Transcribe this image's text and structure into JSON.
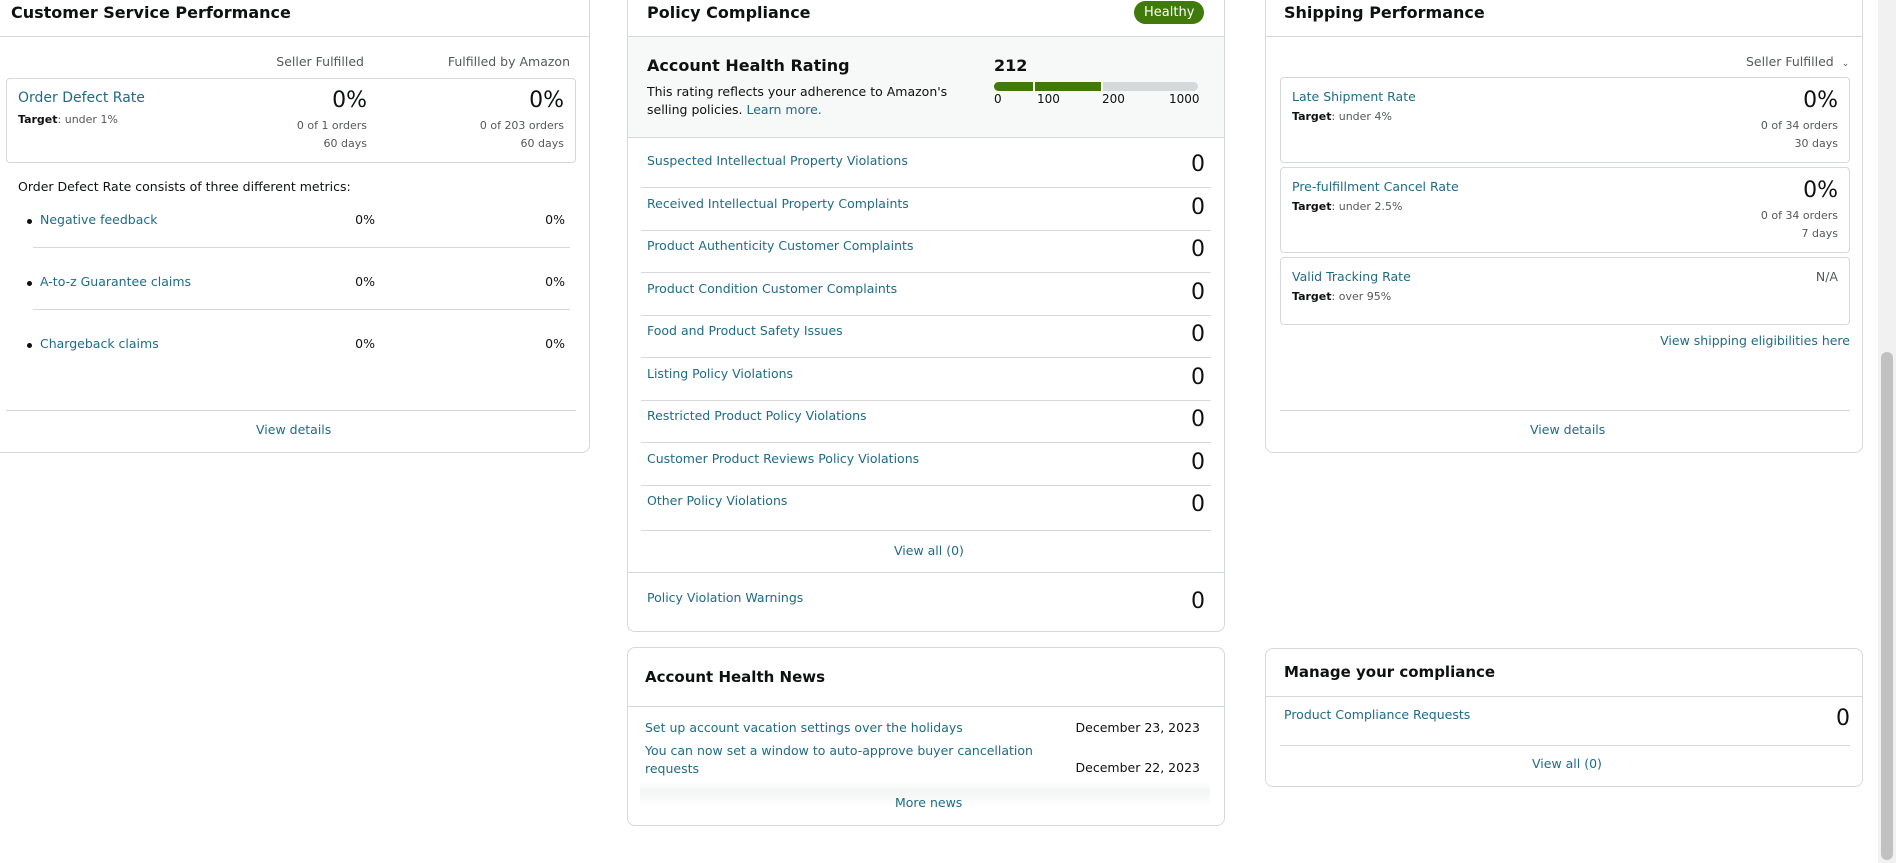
{
  "customer_service": {
    "title": "Customer Service Performance",
    "col1": "Seller Fulfilled",
    "col2": "Fulfilled by Amazon",
    "odr": {
      "label": "Order Defect Rate",
      "target_label": "Target",
      "target_value": ": under 1%",
      "sf_value": "0%",
      "sf_orders": "0 of 1 orders",
      "sf_days": "60 days",
      "fba_value": "0%",
      "fba_orders": "0 of 203 orders",
      "fba_days": "60 days"
    },
    "consists_text": "Order Defect Rate consists of three different metrics:",
    "metrics": [
      {
        "label": "Negative feedback",
        "sf": "0%",
        "fba": "0%"
      },
      {
        "label": "A-to-z Guarantee claims",
        "sf": "0%",
        "fba": "0%"
      },
      {
        "label": "Chargeback claims",
        "sf": "0%",
        "fba": "0%"
      }
    ],
    "view_details": "View details"
  },
  "policy": {
    "title": "Policy Compliance",
    "badge": "Healthy",
    "ahr_title": "Account Health Rating",
    "ahr_desc_line1": "This rating reflects your adherence to Amazon's",
    "ahr_desc_line2": "selling policies.",
    "learn_more": "Learn more.",
    "rating": "212",
    "rating_fraction": 0.212,
    "scale": [
      "0",
      "100",
      "200",
      "1000"
    ],
    "items": [
      {
        "label": "Suspected Intellectual Property Violations",
        "count": "0"
      },
      {
        "label": "Received Intellectual Property Complaints",
        "count": "0"
      },
      {
        "label": "Product Authenticity Customer Complaints",
        "count": "0"
      },
      {
        "label": "Product Condition Customer Complaints",
        "count": "0"
      },
      {
        "label": "Food and Product Safety Issues",
        "count": "0"
      },
      {
        "label": "Listing Policy Violations",
        "count": "0"
      },
      {
        "label": "Restricted Product Policy Violations",
        "count": "0"
      },
      {
        "label": "Customer Product Reviews Policy Violations",
        "count": "0"
      },
      {
        "label": "Other Policy Violations",
        "count": "0"
      }
    ],
    "view_all": "View all (0)",
    "warnings_label": "Policy Violation Warnings",
    "warnings_count": "0"
  },
  "shipping": {
    "title": "Shipping Performance",
    "dropdown": "Seller Fulfilled",
    "metrics": [
      {
        "label": "Late Shipment Rate",
        "target_label": "Target",
        "target_value": ": under 4%",
        "value": "0%",
        "orders": "0 of 34 orders",
        "days": "30 days"
      },
      {
        "label": "Pre-fulfillment Cancel Rate",
        "target_label": "Target",
        "target_value": ": under 2.5%",
        "value": "0%",
        "orders": "0 of 34 orders",
        "days": "7 days"
      },
      {
        "label": "Valid Tracking Rate",
        "target_label": "Target",
        "target_value": ": over 95%",
        "value": "N/A"
      }
    ],
    "eligibility_link": "View shipping eligibilities here",
    "view_details": "View details"
  },
  "news": {
    "title": "Account Health News",
    "items": [
      {
        "line1": "Set up account vacation settings over the holidays",
        "line2": "",
        "date": "December 23, 2023"
      },
      {
        "line1": "You can now set a window to auto-approve buyer cancellation",
        "line2": "requests",
        "date": "December 22, 2023"
      }
    ],
    "more": "More news"
  },
  "compliance": {
    "title": "Manage your compliance",
    "item_label": "Product Compliance Requests",
    "item_count": "0",
    "view_all": "View all (0)"
  },
  "colors": {
    "accent_green": "#3f7a0b",
    "link": "#1f6b85",
    "border": "#d5d9d9"
  }
}
